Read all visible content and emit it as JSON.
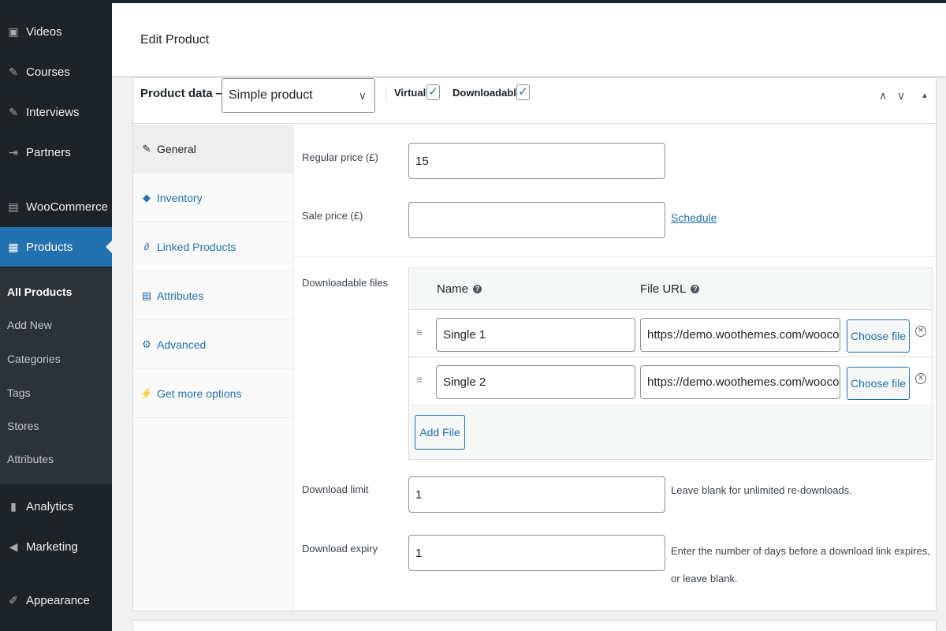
{
  "sidebar": {
    "items_top": [
      {
        "label": "Videos",
        "icon": "video-icon"
      },
      {
        "label": "Courses",
        "icon": "pin-icon"
      },
      {
        "label": "Interviews",
        "icon": "pin-icon"
      },
      {
        "label": "Partners",
        "icon": "partners-icon"
      },
      {
        "label": "WooCommerce",
        "icon": "woocommerce-icon"
      },
      {
        "label": "Products",
        "icon": "archive-icon"
      }
    ],
    "submenu": [
      "All Products",
      "Add New",
      "Categories",
      "Tags",
      "Stores",
      "Attributes"
    ],
    "items_bottom": [
      {
        "label": "Analytics",
        "icon": "chart-bars-icon"
      },
      {
        "label": "Marketing",
        "icon": "megaphone-icon"
      },
      {
        "label": "Appearance",
        "icon": "brush-icon"
      }
    ]
  },
  "header": {
    "title": "Edit Product"
  },
  "product_data": {
    "label": "Product data —",
    "type_selected": "Simple product",
    "virtual_label": "Virtual:",
    "virtual_checked": true,
    "downloadable_label": "Downloadable:",
    "downloadable_checked": true,
    "controls": [
      "^",
      "v",
      "▲"
    ]
  },
  "tabs": [
    {
      "label": "General",
      "icon": "wrench-icon"
    },
    {
      "label": "Inventory",
      "icon": "tag-icon"
    },
    {
      "label": "Linked Products",
      "icon": "link-icon"
    },
    {
      "label": "Attributes",
      "icon": "table-icon"
    },
    {
      "label": "Advanced",
      "icon": "gear-icon"
    },
    {
      "label": "Get more options",
      "icon": "plugin-icon"
    }
  ],
  "general": {
    "regular_price_label": "Regular price (£)",
    "regular_price_value": "15",
    "sale_price_label": "Sale price (£)",
    "sale_price_value": "",
    "schedule_link": "Schedule",
    "downloadable_files_label": "Downloadable files",
    "files_header_name": "Name",
    "files_header_url": "File URL",
    "files": [
      {
        "name": "Single 1",
        "url": "https://demo.woothemes.com/woocomme",
        "button": "Choose file"
      },
      {
        "name": "Single 2",
        "url": "https://demo.woothemes.com/woocomme",
        "button": "Choose file"
      }
    ],
    "add_file_button": "Add File",
    "download_limit_label": "Download limit",
    "download_limit_value": "1",
    "download_limit_help": "Leave blank for unlimited re-downloads.",
    "download_expiry_label": "Download expiry",
    "download_expiry_value": "1",
    "download_expiry_help_1": "Enter the number of days before a download link expires,",
    "download_expiry_help_2": "or leave blank."
  }
}
